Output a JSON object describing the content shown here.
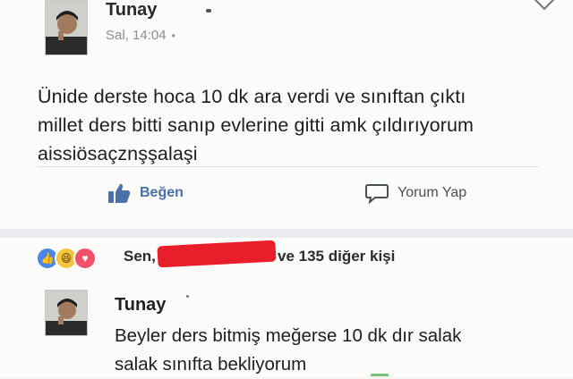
{
  "post": {
    "author": "Tunay",
    "timestamp": "Sal, 14:04",
    "privacy_icon": "globe-icon",
    "text_lines": [
      "Ünide derste hoca 10 dk ara verdi ve sınıftan çıktı",
      "millet ders bitti sanıp evlerine gitti amk çıldırıyorum",
      "aissiösaçznşşalaşi"
    ],
    "actions": {
      "like_label": "Beğen",
      "comment_label": "Yorum Yap"
    }
  },
  "reactions": {
    "icons": [
      "like-reaction-icon",
      "haha-reaction-icon",
      "love-reaction-icon"
    ],
    "prefix": "Sen,",
    "suffix": "ve 135 diğer kişi",
    "colors": {
      "like": "#4a86e8",
      "haha": "#f7c53d",
      "love": "#f25268",
      "redaction": "#e81f2b"
    }
  },
  "comment": {
    "author": "Tunay",
    "text_lines": [
      "Beyler ders bitmiş meğerse 10 dk dır salak",
      "salak sınıfta bekliyorum"
    ]
  }
}
